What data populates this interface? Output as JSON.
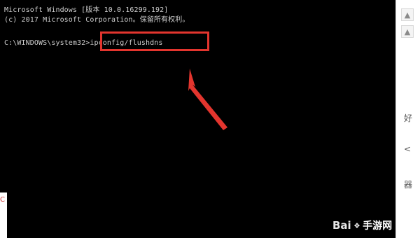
{
  "terminal": {
    "line1": "Microsoft Windows [版本 10.0.16299.192]",
    "line2": "(c) 2017 Microsoft Corporation。保留所有权利。",
    "prompt": "C:\\WINDOWS\\system32>",
    "command": "ipconfig/flushdns"
  },
  "annotation": {
    "highlight_color": "#e3352e"
  },
  "chrome": {
    "up_arrow": "▲",
    "mid_arrow": "▲",
    "bg_text_1": "好",
    "bg_text_2": "<",
    "bg_text_3": "器"
  },
  "left_strip": {
    "text": "C"
  },
  "watermark": {
    "logo": "Bai",
    "paw": "❖",
    "site": "手游网"
  }
}
